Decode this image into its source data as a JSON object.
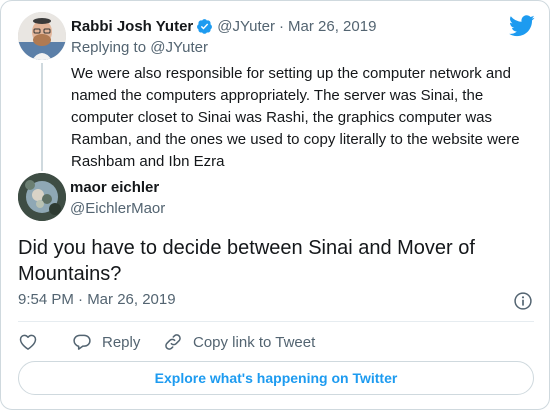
{
  "parent_tweet": {
    "author_name": "Rabbi Josh Yuter",
    "handle": "@JYuter",
    "separator": "·",
    "date": "Mar 26, 2019",
    "replying_prefix": "Replying to",
    "replying_to": "@JYuter",
    "text": "We were also responsible for setting up the computer network and named the computers appropriately. The server was Sinai, the computer closet to Sinai was Rashi, the graphics computer was Ramban, and the ones we used to copy literally to the website were Rashbam and Ibn Ezra"
  },
  "reply_tweet": {
    "author_name": "maor eichler",
    "handle": "@EichlerMaor",
    "text": "Did you have to decide between Sinai and Mover of Mountains?",
    "timestamp": "9:54 PM · Mar 26, 2019"
  },
  "actions": {
    "reply_label": "Reply",
    "copy_label": "Copy link to Tweet"
  },
  "explore_button": {
    "label": "Explore what's happening on Twitter"
  },
  "colors": {
    "brand": "#1d9bf0",
    "verified": "#1d9bf0",
    "secondary_text": "#536471",
    "border": "#cfd9de"
  },
  "icons": {
    "brand": "twitter-bird-icon",
    "verified": "verified-badge-icon",
    "info": "info-icon",
    "like": "heart-icon",
    "reply": "reply-bubble-icon",
    "copy": "link-icon"
  }
}
